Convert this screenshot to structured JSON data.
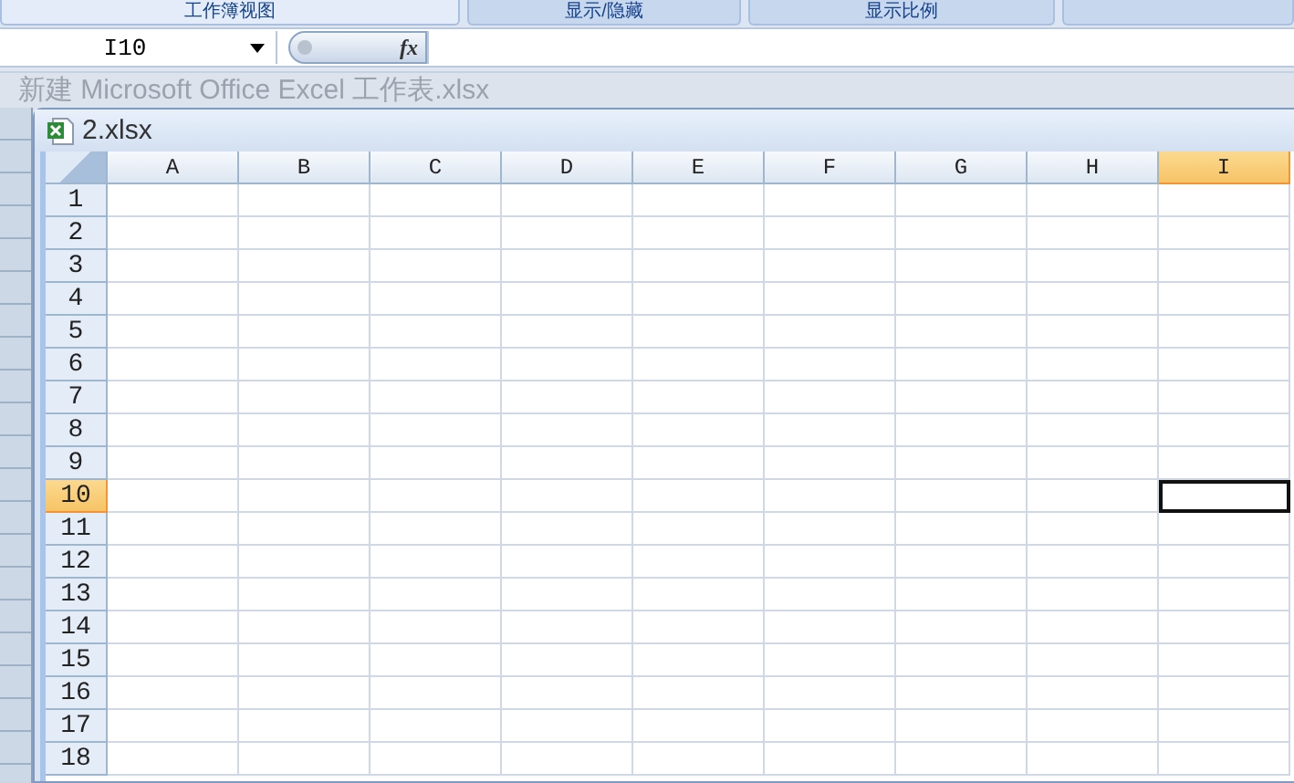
{
  "ribbon_groups": [
    "工作簿视图",
    "显示/隐藏",
    "显示比例"
  ],
  "formula_bar": {
    "name_box": "I10",
    "fx_label": "fx"
  },
  "background_window": {
    "title": "新建 Microsoft Office Excel 工作表.xlsx"
  },
  "workbook": {
    "title": "2.xlsx",
    "columns": [
      {
        "label": "A",
        "selected": false
      },
      {
        "label": "B",
        "selected": false
      },
      {
        "label": "C",
        "selected": false
      },
      {
        "label": "D",
        "selected": false
      },
      {
        "label": "E",
        "selected": false
      },
      {
        "label": "F",
        "selected": false
      },
      {
        "label": "G",
        "selected": false
      },
      {
        "label": "H",
        "selected": false
      },
      {
        "label": "I",
        "selected": true
      }
    ],
    "rows": [
      {
        "label": "1",
        "selected": false
      },
      {
        "label": "2",
        "selected": false
      },
      {
        "label": "3",
        "selected": false
      },
      {
        "label": "4",
        "selected": false
      },
      {
        "label": "5",
        "selected": false
      },
      {
        "label": "6",
        "selected": false
      },
      {
        "label": "7",
        "selected": false
      },
      {
        "label": "8",
        "selected": false
      },
      {
        "label": "9",
        "selected": false
      },
      {
        "label": "10",
        "selected": true
      },
      {
        "label": "11",
        "selected": false
      },
      {
        "label": "12",
        "selected": false
      },
      {
        "label": "13",
        "selected": false
      },
      {
        "label": "14",
        "selected": false
      },
      {
        "label": "15",
        "selected": false
      },
      {
        "label": "16",
        "selected": false
      },
      {
        "label": "17",
        "selected": false
      },
      {
        "label": "18",
        "selected": false
      }
    ]
  }
}
